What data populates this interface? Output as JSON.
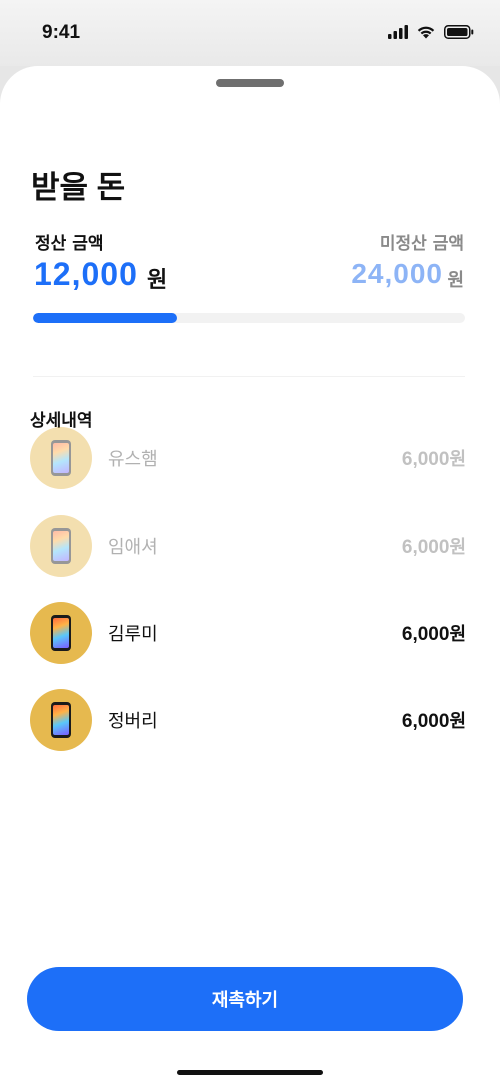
{
  "status_bar": {
    "time": "9:41"
  },
  "sheet": {
    "title": "받을 돈",
    "settled": {
      "label": "정산 금액",
      "amount": "12,000",
      "unit": "원"
    },
    "unsettled": {
      "label": "미정산 금액",
      "amount": "24,000",
      "unit": "원"
    },
    "progress_fraction": 0.333,
    "section_title": "상세내역",
    "items": [
      {
        "name": "유스햄",
        "amount": "6,000",
        "unit": "원",
        "settled": true
      },
      {
        "name": "임애셔",
        "amount": "6,000",
        "unit": "원",
        "settled": true
      },
      {
        "name": "김루미",
        "amount": "6,000",
        "unit": "원",
        "settled": false
      },
      {
        "name": "정버리",
        "amount": "6,000",
        "unit": "원",
        "settled": false
      }
    ],
    "cta_label": "재촉하기"
  },
  "colors": {
    "accent": "#1d6ff8",
    "accent_light": "#8db4f6",
    "avatar": "#e6b94f"
  }
}
